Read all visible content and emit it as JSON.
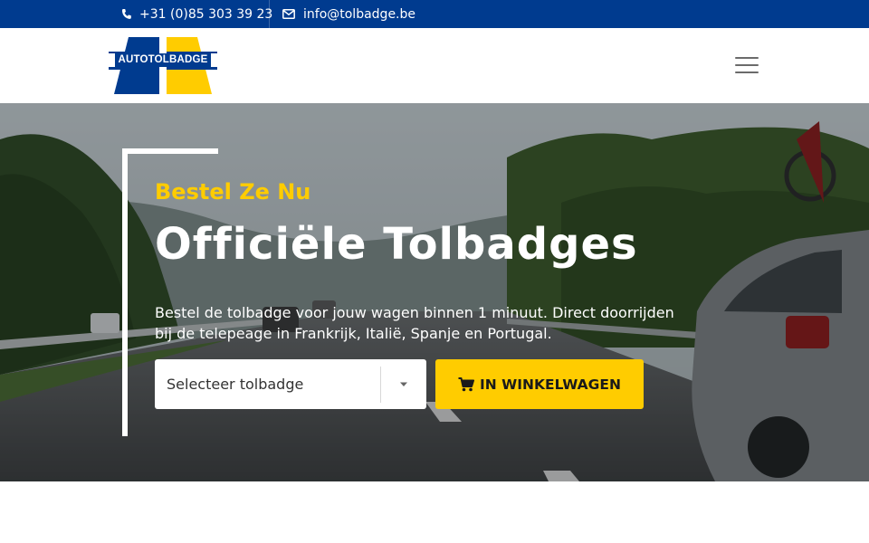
{
  "topbar": {
    "phone": "+31 (0)85 303 39 23",
    "email": "info@tolbadge.be"
  },
  "header": {
    "logo_text": "AUTOTOLBADGE"
  },
  "hero": {
    "eyebrow": "Bestel Ze Nu",
    "title": "Officiële Tolbadges",
    "description": "Bestel de tolbadge voor jouw wagen binnen 1 minuut. Direct doorrijden bij de telepeage in Frankrijk, Italië, Spanje en Portugal.",
    "select_value": "Selecteer tolbadge",
    "cart_button": "IN WINKELWAGEN"
  },
  "colors": {
    "brand_blue": "#003b8f",
    "accent_yellow": "#ffcc00"
  }
}
